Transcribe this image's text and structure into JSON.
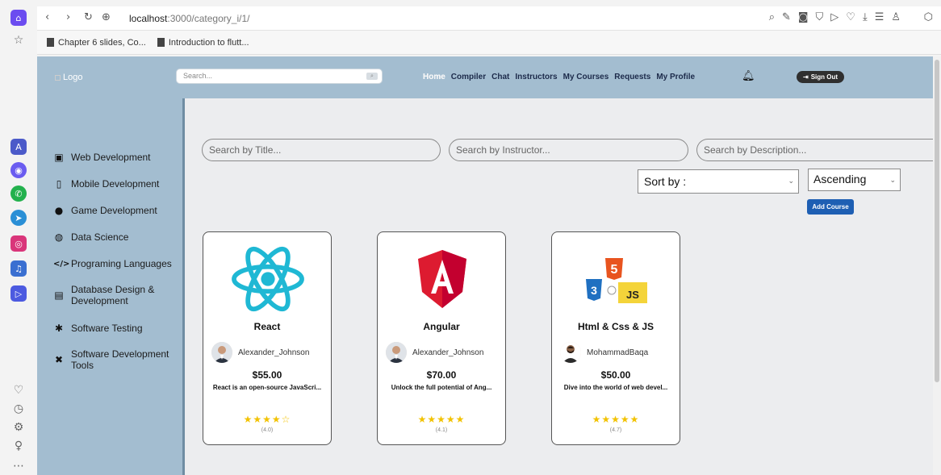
{
  "browser": {
    "url_host": "localhost",
    "url_path": ":3000/category_i/1/",
    "bookmarks": [
      "Chapter 6 slides, Co...",
      "Introduction to flutt..."
    ]
  },
  "header": {
    "logo_alt": "Logo",
    "search_placeholder": "Search...",
    "nav": [
      "Home",
      "Compiler",
      "Chat",
      "Instructors",
      "My Courses",
      "Requests",
      "My Profile"
    ],
    "active_nav": "Home",
    "signout_label": "Sign Out"
  },
  "sidebar": {
    "items": [
      {
        "label": "Web Development",
        "icon": "monitor-icon"
      },
      {
        "label": "Mobile Development",
        "icon": "mobile-icon"
      },
      {
        "label": "Game Development",
        "icon": "gamepad-icon"
      },
      {
        "label": "Data Science",
        "icon": "robot-icon"
      },
      {
        "label": "Programing Languages",
        "icon": "code-icon"
      },
      {
        "label": "Database Design & Development",
        "icon": "database-icon"
      },
      {
        "label": "Software Testing",
        "icon": "bug-icon"
      },
      {
        "label": "Software Development Tools",
        "icon": "tools-icon"
      }
    ]
  },
  "filters": {
    "title_placeholder": "Search by Title...",
    "instructor_placeholder": "Search by Instructor...",
    "description_placeholder": "Search by Description...",
    "sort_label": "Sort by :",
    "order_value": "Ascending",
    "add_course_label": "Add Course"
  },
  "courses": [
    {
      "title": "React",
      "instructor": "Alexander_Johnson",
      "price": "$55.00",
      "description": "React is an open-source JavaScri...",
      "stars": "★★★★☆",
      "rating": "(4.0)",
      "image": "react-logo-icon"
    },
    {
      "title": "Angular",
      "instructor": "Alexander_Johnson",
      "price": "$70.00",
      "description": "Unlock the full potential of Ang...",
      "stars": "★★★★★",
      "rating": "(4.1)",
      "image": "angular-logo-icon"
    },
    {
      "title": "Html & Css & JS",
      "instructor": "MohammadBaqa",
      "price": "$50.00",
      "description": "Dive into the world of web devel...",
      "stars": "★★★★★",
      "rating": "(4.7)",
      "image": "html-css-js-logo-icon"
    }
  ],
  "colors": {
    "header": "#a3bdd0",
    "accent": "#1e5fb3",
    "star": "#f2c200"
  }
}
